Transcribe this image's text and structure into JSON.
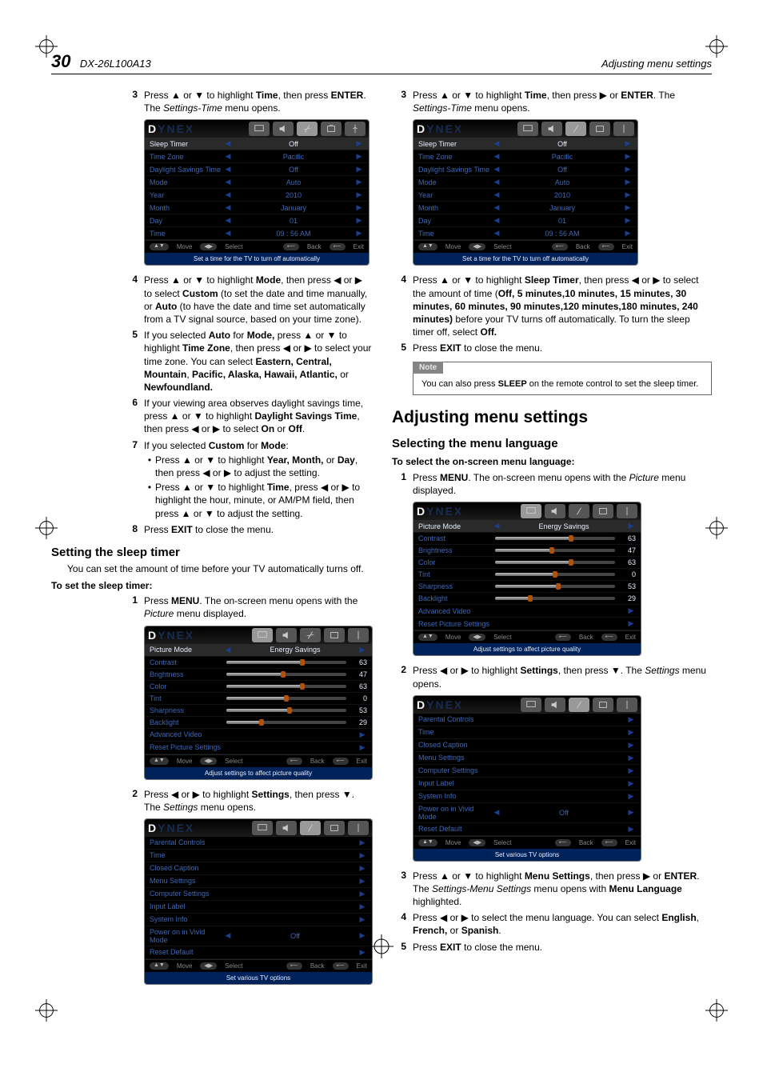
{
  "header": {
    "page_number": "30",
    "model": "DX-26L100A13",
    "right": "Adjusting menu settings"
  },
  "brand": {
    "pre": "D",
    "accent": "YNEX"
  },
  "osd_tabs": {
    "labels": [
      "Picture",
      "Audio",
      "Settings",
      "Channels",
      "USB"
    ]
  },
  "left": {
    "step3": {
      "num": "3",
      "line": "Press ▲ or ▼ to highlight ",
      "bold1": "Time",
      "mid": ", then press ",
      "bold2": "ENTER",
      "end": ". The ",
      "ital": "Settings-Time",
      "tail": " menu opens."
    },
    "osd_time": {
      "rows": [
        {
          "label": "Sleep Timer",
          "val": "Off",
          "hl": true
        },
        {
          "label": "Time Zone",
          "val": "Pacific"
        },
        {
          "label": "Daylight Savings Time",
          "val": "Off"
        },
        {
          "label": "Mode",
          "val": "Auto"
        },
        {
          "label": "Year",
          "val": "2010"
        },
        {
          "label": "Month",
          "val": "January"
        },
        {
          "label": "Day",
          "val": "01"
        },
        {
          "label": "Time",
          "val": "09 : 56  AM"
        }
      ],
      "hint": "Set a time for the TV to turn off automatically"
    },
    "step4": {
      "num": "4",
      "body": "Press ▲ or ▼ to highlight Mode, then press ◀ or ▶ to select Custom (to set the date and time manually, or Auto (to have the date and time set automatically from a TV signal source, based on your time zone)."
    },
    "step5": {
      "num": "5",
      "body": "If you selected Auto for Mode, press ▲ or ▼ to highlight Time Zone, then press ◀ or ▶ to select your time zone. You can select Eastern, Central, Mountain, Pacific, Alaska, Hawaii, Atlantic, or Newfoundland."
    },
    "step6": {
      "num": "6",
      "body": "If your viewing area observes daylight savings time, press ▲ or ▼ to highlight Daylight Savings Time, then press ◀ or ▶ to select On or Off."
    },
    "step7": {
      "num": "7",
      "body": "If you selected Custom for Mode:",
      "sub1": "Press ▲ or ▼ to highlight Year, Month, or Day, then press ◀ or ▶ to adjust the setting.",
      "sub2": "Press ▲ or ▼ to highlight Time, press ◀ or ▶ to highlight the hour, minute, or AM/PM field, then press ▲ or ▼ to adjust the setting."
    },
    "step8": {
      "num": "8",
      "body": "Press EXIT to close the menu."
    },
    "sleep_heading": "Setting the sleep timer",
    "sleep_intro": "You can set the amount of time before your TV automatically turns off.",
    "sleep_sub": "To set the sleep timer:",
    "sleep_step1": {
      "num": "1",
      "body": "Press MENU. The on-screen menu opens with the Picture menu displayed."
    },
    "osd_picture": {
      "rows": [
        {
          "label": "Picture Mode",
          "val": "Energy Savings",
          "hl": true,
          "type": "select"
        },
        {
          "label": "Contrast",
          "num": "63",
          "pct": 63
        },
        {
          "label": "Brightness",
          "num": "47",
          "pct": 47
        },
        {
          "label": "Color",
          "num": "63",
          "pct": 63
        },
        {
          "label": "Tint",
          "num": "0",
          "pct": 50
        },
        {
          "label": "Sharpness",
          "num": "53",
          "pct": 53
        },
        {
          "label": "Backlight",
          "num": "29",
          "pct": 29
        },
        {
          "label": "Advanced Video",
          "type": "link"
        },
        {
          "label": "Reset Picture Settings",
          "type": "link"
        }
      ],
      "hint": "Adjust settings to affect picture quality"
    },
    "sleep_step2": {
      "num": "2",
      "body": "Press ◀ or ▶ to highlight Settings, then press ▼. The Settings menu opens."
    },
    "osd_settings": {
      "rows": [
        {
          "label": "Parental Controls"
        },
        {
          "label": "Time"
        },
        {
          "label": "Closed Caption"
        },
        {
          "label": "Menu Settings"
        },
        {
          "label": "Computer Settings"
        },
        {
          "label": "Input Label"
        },
        {
          "label": "System Info"
        },
        {
          "label": "Power on in Vivid Mode",
          "val": "Off",
          "type": "select"
        },
        {
          "label": "Reset Default"
        }
      ],
      "hint": "Set various TV options"
    }
  },
  "right": {
    "step3": {
      "num": "3",
      "body": "Press ▲ or ▼ to highlight Time, then press ▶ or ENTER. The Settings-Time menu opens."
    },
    "osd_time": {
      "rows": [
        {
          "label": "Sleep Timer",
          "val": "Off",
          "hl": true
        },
        {
          "label": "Time Zone",
          "val": "Pacific"
        },
        {
          "label": "Daylight Savings Time",
          "val": "Off"
        },
        {
          "label": "Mode",
          "val": "Auto"
        },
        {
          "label": "Year",
          "val": "2010"
        },
        {
          "label": "Month",
          "val": "January"
        },
        {
          "label": "Day",
          "val": "01"
        },
        {
          "label": "Time",
          "val": "09 : 56  AM"
        }
      ],
      "hint": "Set a time for the TV to turn off automatically"
    },
    "step4": {
      "num": "4",
      "body": "Press ▲ or ▼ to highlight Sleep Timer, then press ◀ or ▶ to select the amount of time (Off, 5 minutes, 10 minutes, 15 minutes, 30 minutes, 60 minutes, 90 minutes, 120 minutes, 180 minutes, 240 minutes) before your TV turns off automatically. To turn the sleep timer off, select Off."
    },
    "step5": {
      "num": "5",
      "body": "Press EXIT to close the menu."
    },
    "note": {
      "label": "Note",
      "body": "You can also press SLEEP on the remote control to set the sleep timer."
    },
    "main_heading": "Adjusting menu settings",
    "subsection": "Selecting the menu language",
    "subhead": "To select the on-screen menu language:",
    "m_step1": {
      "num": "1",
      "body": "Press MENU. The on-screen menu opens with the Picture menu displayed."
    },
    "osd_picture": {
      "rows": [
        {
          "label": "Picture Mode",
          "val": "Energy Savings",
          "hl": true,
          "type": "select"
        },
        {
          "label": "Contrast",
          "num": "63",
          "pct": 63
        },
        {
          "label": "Brightness",
          "num": "47",
          "pct": 47
        },
        {
          "label": "Color",
          "num": "63",
          "pct": 63
        },
        {
          "label": "Tint",
          "num": "0",
          "pct": 50
        },
        {
          "label": "Sharpness",
          "num": "53",
          "pct": 53
        },
        {
          "label": "Backlight",
          "num": "29",
          "pct": 29
        },
        {
          "label": "Advanced Video",
          "type": "link"
        },
        {
          "label": "Reset Picture Settings",
          "type": "link"
        }
      ],
      "hint": "Adjust settings to affect picture quality"
    },
    "m_step2": {
      "num": "2",
      "body": "Press ◀ or ▶ to highlight Settings, then press ▼. The Settings menu opens."
    },
    "osd_settings": {
      "rows": [
        {
          "label": "Parental Controls"
        },
        {
          "label": "Time"
        },
        {
          "label": "Closed Caption"
        },
        {
          "label": "Menu Settings"
        },
        {
          "label": "Computer Settings"
        },
        {
          "label": "Input Label"
        },
        {
          "label": "System Info"
        },
        {
          "label": "Power on in Vivid Mode",
          "val": "Off",
          "type": "select"
        },
        {
          "label": "Reset Default"
        }
      ],
      "hint": "Set various TV options"
    },
    "m_step3": {
      "num": "3",
      "body": "Press ▲ or ▼ to highlight Menu Settings, then press ▶ or ENTER. The Settings-Menu Settings menu opens with Menu Language highlighted."
    },
    "m_step4": {
      "num": "4",
      "body": "Press ◀ or ▶ to select the menu language. You can select English, French, or Spanish."
    },
    "m_step5": {
      "num": "5",
      "body": "Press EXIT to close the menu."
    }
  },
  "nav": {
    "move": "Move",
    "select": "Select",
    "back": "Back",
    "exit": "Exit"
  }
}
